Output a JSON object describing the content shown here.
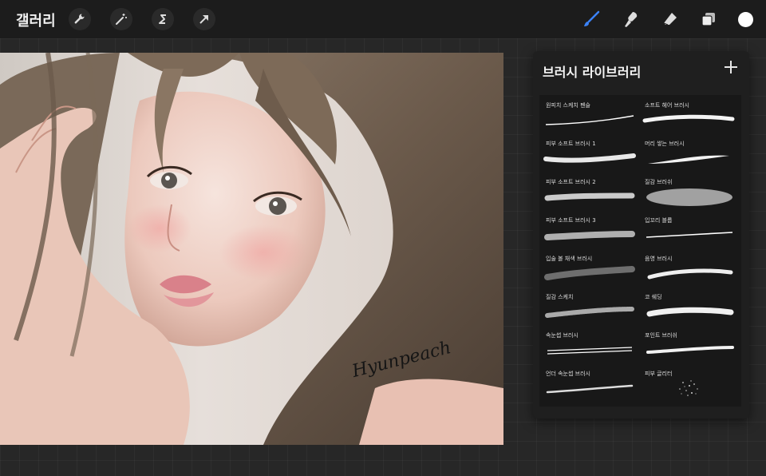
{
  "app": {
    "gallery_label": "갤러리"
  },
  "toolbar": {
    "left_tools": [
      {
        "name": "wrench-icon"
      },
      {
        "name": "magic-wand-icon"
      },
      {
        "name": "selection-s-icon"
      },
      {
        "name": "arrow-icon"
      }
    ],
    "right_tools": [
      {
        "name": "brush-icon",
        "active": true,
        "color": "#3b82f6"
      },
      {
        "name": "smudge-icon"
      },
      {
        "name": "eraser-icon"
      },
      {
        "name": "layers-icon"
      }
    ],
    "current_color": "#ffffff"
  },
  "canvas": {
    "signature": "Hyunpeach"
  },
  "brush_library": {
    "title": "브러시 라이브러리",
    "add_label": "+",
    "brushes": [
      {
        "name": "원피치 스케치 펜슬"
      },
      {
        "name": "소프트 헤어 브러시"
      },
      {
        "name": "피부 소프트 브러시 1"
      },
      {
        "name": "머리 쌓는 브러시"
      },
      {
        "name": "피부 소프트 브러시 2"
      },
      {
        "name": "질감 브러쉬"
      },
      {
        "name": "피부 소프트 브러시 3"
      },
      {
        "name": "입꼬리 블롭"
      },
      {
        "name": "입술 볼 채색 브러시"
      },
      {
        "name": "음영 브러시"
      },
      {
        "name": "질감 스케치"
      },
      {
        "name": "코 쉐딩"
      },
      {
        "name": "속눈썹 브러시"
      },
      {
        "name": "포인트 브러쉬"
      },
      {
        "name": "언더 속눈썹 브러시"
      },
      {
        "name": "피부 글리터"
      }
    ]
  }
}
